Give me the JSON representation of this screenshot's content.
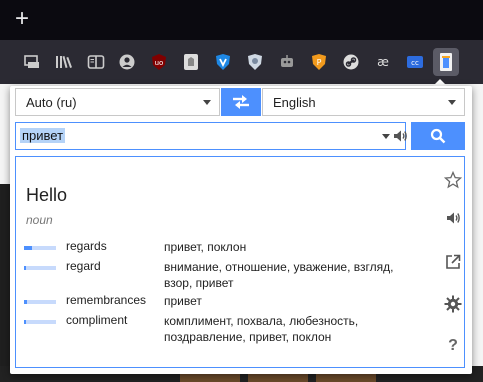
{
  "browser": {
    "new_tab_glyph": "+",
    "toolbar_icons": [
      "container-tabs-icon",
      "library-icon",
      "reader-view-icon",
      "account-icon",
      "ublock-icon",
      "page-icon",
      "vpn-shield-icon",
      "shield-icon",
      "robot-icon",
      "fox-shield-icon",
      "link-icon",
      "ae-icon",
      "cc-icon",
      "translator-extension-icon"
    ]
  },
  "translator": {
    "source_lang": "Auto (ru)",
    "target_lang": "English",
    "query": "привет",
    "headword": "Hello",
    "part_of_speech": "noun",
    "entries": [
      {
        "term": "regards",
        "translations": "привет, поклон",
        "frequency": 0.25
      },
      {
        "term": "regard",
        "translations": "внимание, отношение, уважение, взгляд, взор, привет",
        "frequency": 0.05
      },
      {
        "term": "remembrances",
        "translations": "привет",
        "frequency": 0.1
      },
      {
        "term": "compliment",
        "translations": "комплимент, похвала, любезность, поздравление, привет, поклон",
        "frequency": 0.05
      }
    ],
    "help_glyph": "?"
  },
  "colors": {
    "accent": "#4d90fe",
    "popup_bg": "#ffffff",
    "toolbar": "#2b2a33"
  }
}
